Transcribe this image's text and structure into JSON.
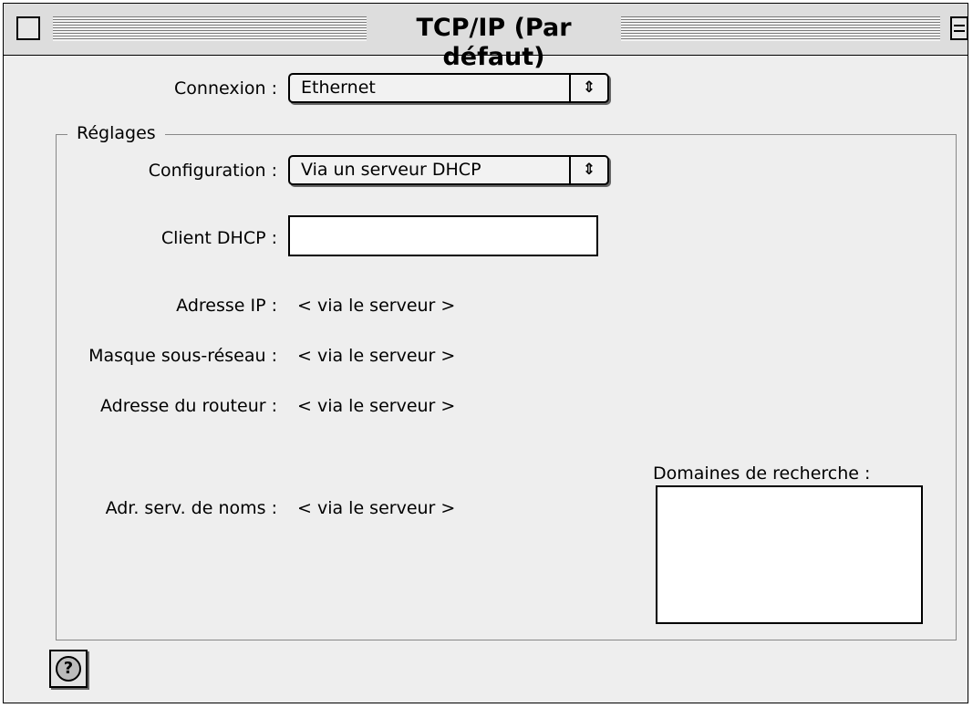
{
  "window": {
    "title": "TCP/IP (Par défaut)"
  },
  "connexion": {
    "label": "Connexion :",
    "value": "Ethernet"
  },
  "settings": {
    "group_title": "Réglages",
    "configuration": {
      "label": "Configuration :",
      "value": "Via un serveur DHCP"
    },
    "dhcp_client": {
      "label": "Client DHCP :",
      "value": ""
    },
    "ip_address": {
      "label": "Adresse IP :",
      "value": "< via le serveur >"
    },
    "subnet_mask": {
      "label": "Masque sous-réseau :",
      "value": "< via le serveur >"
    },
    "router_address": {
      "label": "Adresse du routeur :",
      "value": "< via le serveur >"
    },
    "name_servers": {
      "label": "Adr. serv. de noms :",
      "value": "< via le serveur >"
    },
    "search_domains": {
      "label": "Domaines de recherche :",
      "value": ""
    }
  },
  "help": {
    "symbol": "?"
  },
  "icons": {
    "popup_arrow": "⇕"
  }
}
